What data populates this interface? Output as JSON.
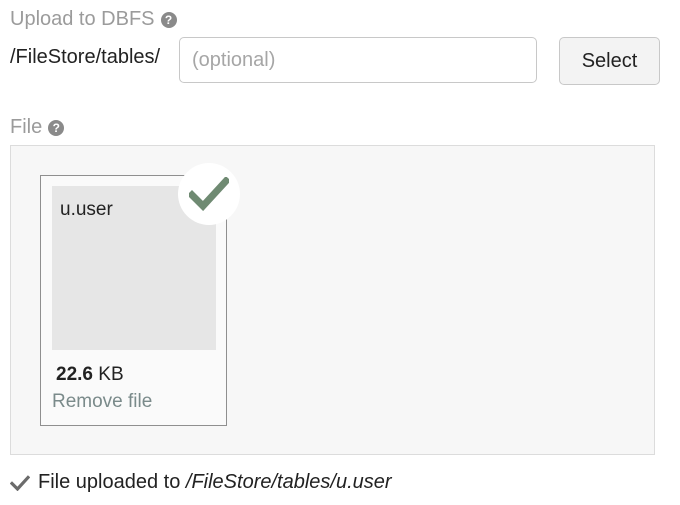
{
  "upload": {
    "label": "Upload to DBFS",
    "help_icon": "question-circle-icon",
    "path_prefix": "/FileStore/tables/",
    "path_input_value": "",
    "path_input_placeholder": "(optional)",
    "select_label": "Select"
  },
  "file_section": {
    "label": "File",
    "help_icon": "question-circle-icon",
    "file": {
      "name": "u.user",
      "size_value": "22.6",
      "size_unit": "KB",
      "remove_label": "Remove file",
      "status_icon": "checkmark-icon"
    }
  },
  "status": {
    "icon": "checkmark-icon",
    "text": "File uploaded to",
    "path": "/FileStore/tables/u.user"
  },
  "colors": {
    "check_green": "#6f8a72",
    "muted_label": "#9b9b9b",
    "link_gray": "#7a8a8a"
  }
}
